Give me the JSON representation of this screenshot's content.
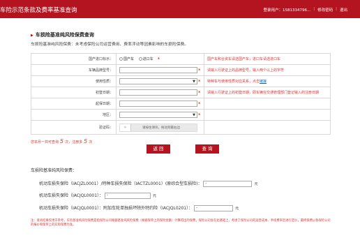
{
  "header": {
    "title": "车险示范条款及费率基准查询",
    "user_label": "登录用户：15813347​96...",
    "change_password": "修改密码",
    "logout": "退出",
    "separator": "|"
  },
  "section": {
    "title": "车损险基准纯风险保费查询",
    "description": "车损险基准纯风险保费：未考虑保险公司运营费用、费率浮动等因素影响的车损险保费。"
  },
  "form": {
    "origin": {
      "label": "国产进口标示：",
      "option1": "国产车",
      "option2": "进口车",
      "required": "*",
      "hint": "国产车和合资车请选国产车；进口车请选进口车"
    },
    "model": {
      "label": "车辆品牌型号：",
      "required": "*",
      "hint": "请输入行驶证上的品牌型号，输入两个以上的字符"
    },
    "usage": {
      "label": "使用性质：",
      "required": "*",
      "hint": "特种车与使用性质对应关系，点击",
      "hint_link": "链接"
    },
    "first_reg": {
      "label": "初登日期：",
      "required": "*",
      "hint": "请输入行驶证上的初登日期，即车辆在交通管理部门登记输入的注册日期"
    },
    "start_date": {
      "label": "起保日期：",
      "required": "*"
    },
    "region": {
      "label": "地区：",
      "required": "*"
    },
    "captcha": {
      "label": "验证码：",
      "knob": "»",
      "text": "请按住滑块，拖动到最右边"
    }
  },
  "query_count": {
    "prefix": "您本月一共可查询",
    "total": "5",
    "middle": "次，注册多",
    "extra": "5",
    "suffix": "次"
  },
  "buttons": {
    "back": "返 回",
    "query": "查 询"
  },
  "premiums": {
    "title": "车损险基准纯风险保费：",
    "row1_label": "机动车损失保险（IACJZL0001）/特种车损失保险（IACTZL0001）(原综合型车损险)：",
    "row1_value": "-",
    "row2_label": "机动车损失保险（IACJQL0001）：",
    "row2_value": "-",
    "row3_label": "机动车损失保险（IACJQL0001）：附加车轮单独损坏除外特约险（IACJQL0201）：",
    "row3_value": "-",
    "unit": "元"
  },
  "note": "注：查询结果仅用于参考，车险基准纯风险保费是指保险公司根据基准纯风险保费（根据保单上的保险金额）计算得出的保费，保险公司会在此基础上，考虑了保险公司的运营成本、手续费率后进行定价，最终保费以各保险公司的报价和保单上的实际保费为准。"
}
